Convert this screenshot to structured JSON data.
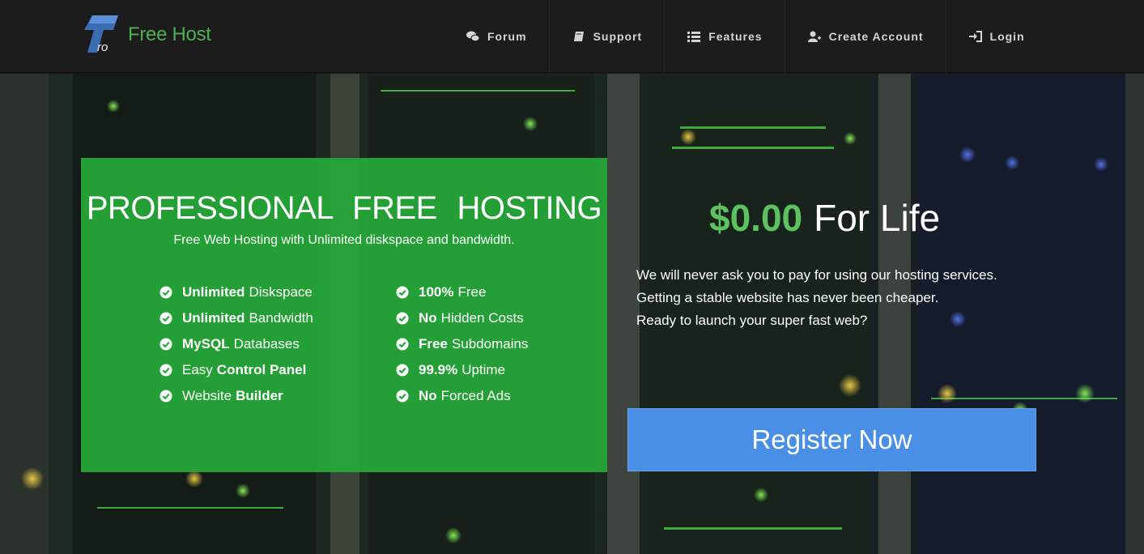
{
  "brand": {
    "name": "Free Host",
    "logo_icon": "ro-logo-icon",
    "color": "#4caf50"
  },
  "nav": [
    {
      "label": "Forum",
      "icon": "chat-bubbles-icon"
    },
    {
      "label": "Support",
      "icon": "book-icon"
    },
    {
      "label": "Features",
      "icon": "list-icon"
    },
    {
      "label": "Create Account",
      "icon": "user-plus-icon"
    },
    {
      "label": "Login",
      "icon": "sign-in-icon"
    }
  ],
  "hero": {
    "title": "PROFESSIONAL FREE HOSTING",
    "subtitle": "Free Web Hosting with Unlimited diskspace and bandwidth.",
    "features_left": [
      {
        "bold": "Unlimited",
        "text": "Diskspace"
      },
      {
        "bold": "Unlimited",
        "text": "Bandwidth"
      },
      {
        "bold": "MySQL",
        "text": "Databases"
      },
      {
        "pre": "Easy",
        "bold": "Control Panel"
      },
      {
        "pre": "Website",
        "bold": "Builder"
      }
    ],
    "features_right": [
      {
        "bold": "100%",
        "text": "Free"
      },
      {
        "bold": "No",
        "text": "Hidden Costs"
      },
      {
        "bold": "Free",
        "text": "Subdomains"
      },
      {
        "bold": "99.9%",
        "text": "Uptime"
      },
      {
        "bold": "No",
        "text": "Forced Ads"
      }
    ],
    "price_amount": "$0.00",
    "price_suffix": "For Life",
    "description": [
      "We will never ask you to pay for using our hosting services.",
      "Getting a stable website has never been cheaper.",
      "Ready to launch your super fast web?"
    ],
    "cta_label": "Register Now"
  },
  "colors": {
    "accent_green": "#26aa38",
    "price_green": "#5cc15e",
    "cta_blue": "#4a8fe6",
    "nav_bg": "#1c1c1c"
  }
}
